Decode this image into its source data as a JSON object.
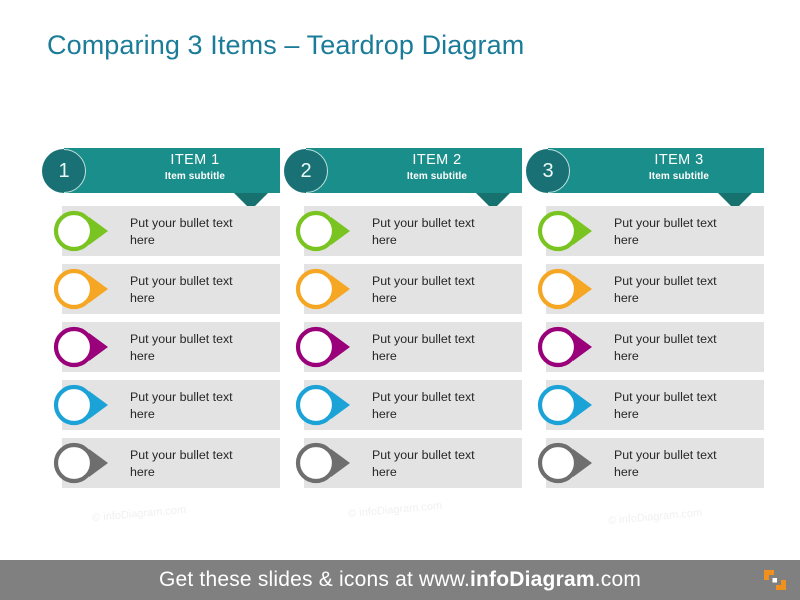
{
  "slide": {
    "title": "Comparing 3 Items – Teardrop Diagram",
    "title_color": "#1b7c99",
    "background": "#ffffff"
  },
  "theme": {
    "header_teal": "#1a8e8a",
    "header_arrow_teal": "#16716f",
    "number_circle_teal": "#197175",
    "row_background": "#e3e3e3",
    "row_text_color": "#262626",
    "footer_background": "#808080",
    "footer_text_color": "#ffffff",
    "logo_orange": "#f2901e"
  },
  "bullet_colors": [
    {
      "name": "green",
      "hex": "#7ac422"
    },
    {
      "name": "orange",
      "hex": "#f5a623"
    },
    {
      "name": "purple",
      "hex": "#99007a"
    },
    {
      "name": "blue",
      "hex": "#1ba3d8"
    },
    {
      "name": "gray",
      "hex": "#6e6e6e"
    }
  ],
  "columns": [
    {
      "number": "1",
      "title": "ITEM 1",
      "subtitle": "Item subtitle",
      "bullets": [
        "Put your bullet text here",
        "Put your bullet text here",
        "Put your bullet text here",
        "Put your bullet text here",
        "Put your bullet text here"
      ]
    },
    {
      "number": "2",
      "title": "ITEM 2",
      "subtitle": "Item subtitle",
      "bullets": [
        "Put your bullet text here",
        "Put your bullet text here",
        "Put your bullet text here",
        "Put your bullet text here",
        "Put your bullet text here"
      ]
    },
    {
      "number": "3",
      "title": "ITEM 3",
      "subtitle": "Item subtitle",
      "bullets": [
        "Put your bullet text here",
        "Put your bullet text here",
        "Put your bullet text here",
        "Put your bullet text here",
        "Put your bullet text here"
      ]
    }
  ],
  "watermarks": [
    "© infoDiagram.com",
    "© infoDiagram.com",
    "© infoDiagram.com"
  ],
  "footer": {
    "text_lead": "Get these slides & icons at www.",
    "text_strong": "infoDiagram",
    "text_tail": ".com",
    "logo": "infodiagram-logo-icon"
  }
}
